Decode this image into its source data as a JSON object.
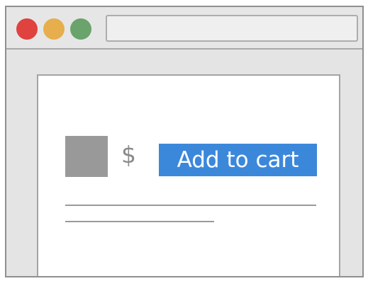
{
  "window": {
    "controls": {
      "close_color": "#e0423f",
      "minimize_color": "#e6ae4c",
      "zoom_color": "#6aa36b"
    },
    "address_bar": {
      "value": ""
    }
  },
  "product": {
    "image_icon": "image-placeholder",
    "price_symbol": "$",
    "add_to_cart_label": "Add to cart",
    "accent_color": "#3b88db"
  }
}
